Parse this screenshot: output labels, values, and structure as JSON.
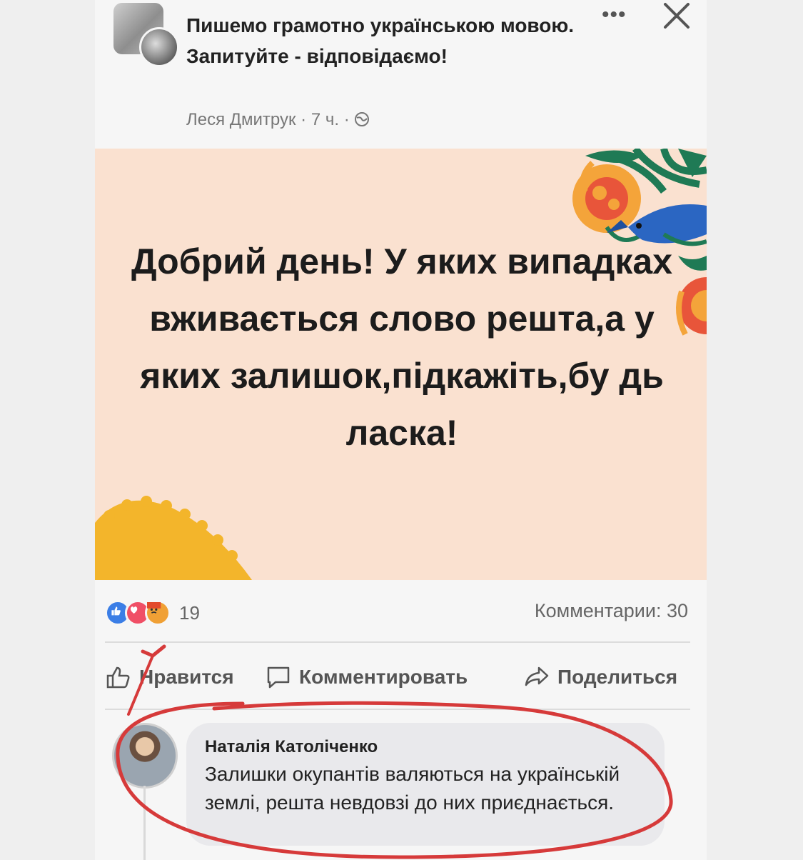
{
  "header": {
    "group_title": "Пишемо грамотно українською мовою. Запитуйте - відповідаємо!",
    "author": "Леся Дмитрук",
    "separator": "·",
    "time": "7 ч.",
    "privacy_icon": "globe-icon",
    "more_icon": "more-dots-icon",
    "close_icon": "close-icon"
  },
  "post": {
    "text": "Добрий день! У яких випадках вживається слово решта,а у яких залишок,підкажіть,бу дь ласка!",
    "background_color": "#fae1d0"
  },
  "stats": {
    "reaction_count": "19",
    "comments_label": "Комментарии: 30"
  },
  "actions": {
    "like_label": "Нравится",
    "comment_label": "Комментировать",
    "share_label": "Поделиться"
  },
  "comment": {
    "author": "Наталія Католіченко",
    "text": "Залишки окупантів валяються на українській землі, решта невдовзі до них приєднається."
  },
  "colors": {
    "annotation_red": "#d63a3a",
    "like_blue": "#3b7ee6"
  }
}
